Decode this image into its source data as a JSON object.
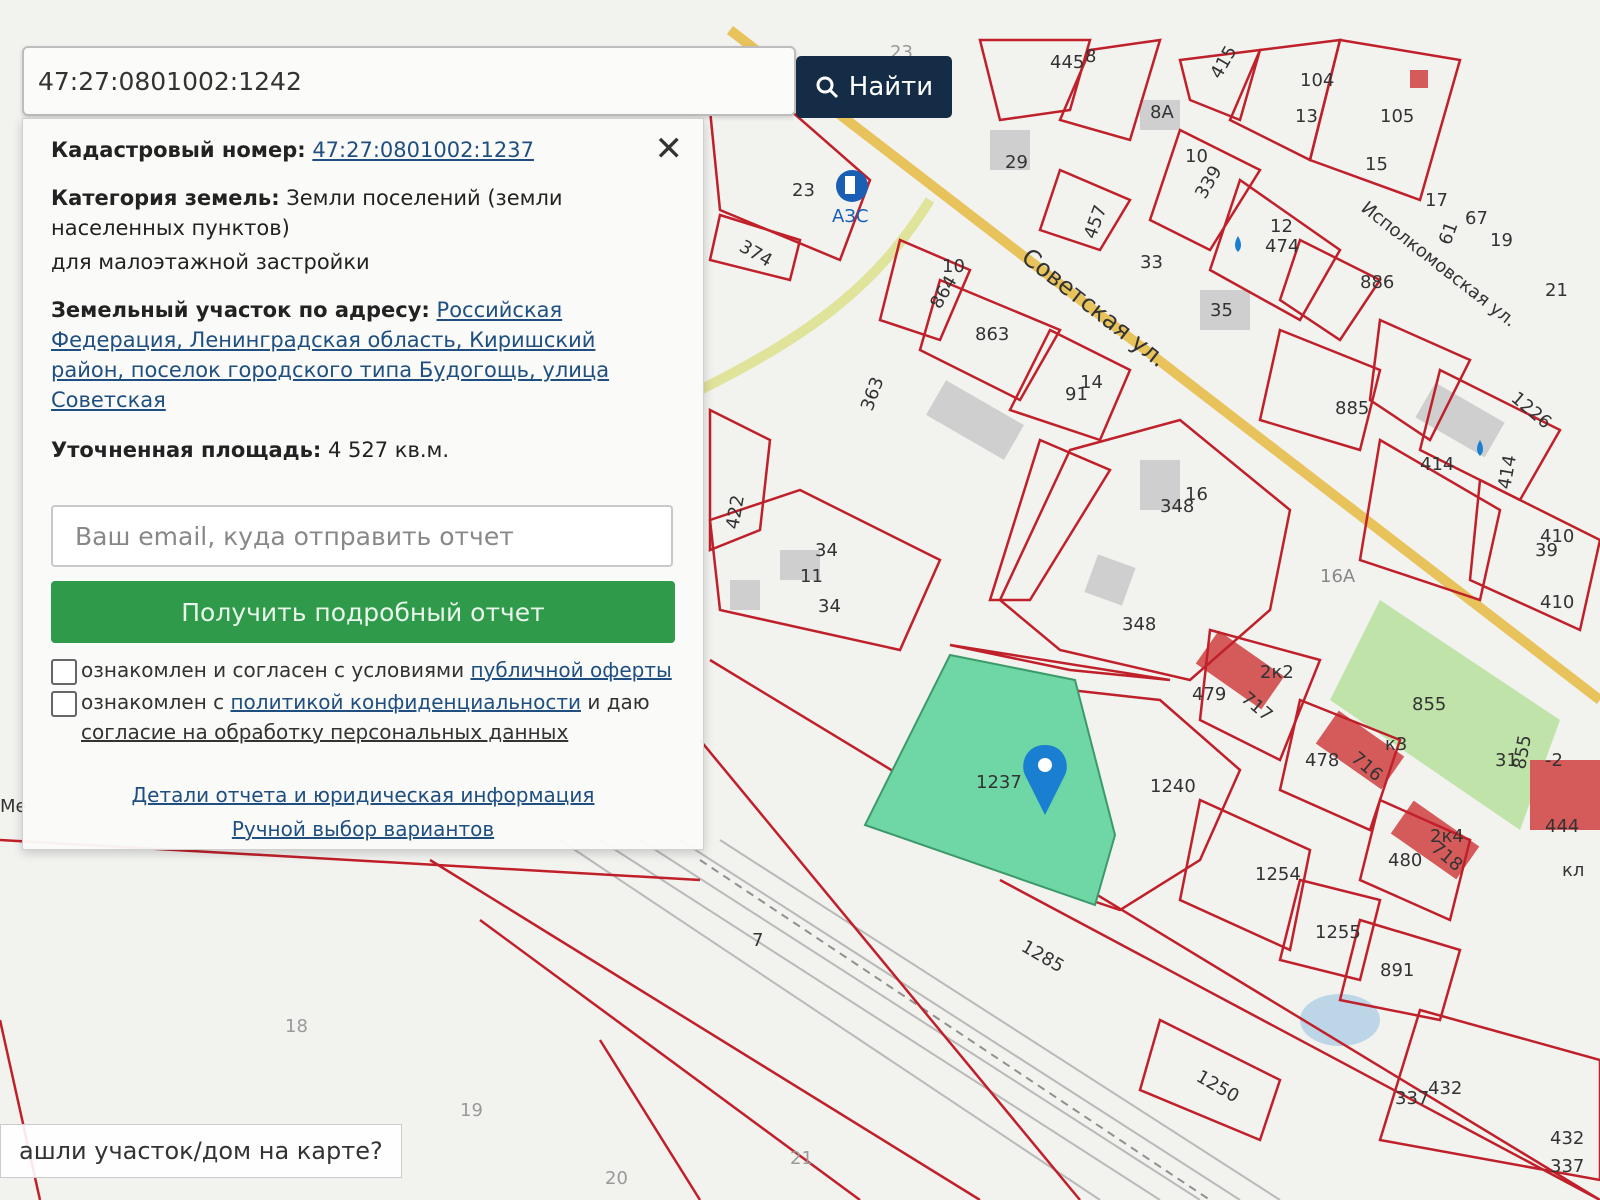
{
  "search": {
    "value": "47:27:0801002:1242",
    "button_label": "Найти"
  },
  "panel": {
    "cadastral_label": "Кадастровый номер:",
    "cadastral_value": "47:27:0801002:1237",
    "category_label": "Категория земель:",
    "category_value_1": "Земли поселений (земли",
    "category_value_2": "населенных пунктов)",
    "category_value_3": "для малоэтажной застройки",
    "address_label": "Земельный участок по адресу:",
    "address_1": "Российская",
    "address_2": "Федерация, Ленинградская область, Киришский",
    "address_3": "район, поселок городского типа Будогощь, улица",
    "address_4": "Советская",
    "area_label": "Уточненная площадь:",
    "area_value": "4 527 кв.м.",
    "email_placeholder": "Ваш email, куда отправить отчет",
    "report_button": "Получить подробный отчет",
    "offer_text": "ознакомлен и согласен с условиями",
    "offer_link": "публичной оферты",
    "privacy_text_1": "ознакомлен с",
    "privacy_link": "политикой конфиденциальности",
    "privacy_text_2": "и даю",
    "consent_link": "согласие на обработку персональных данных",
    "details_link": "Детали отчета и юридическая информация",
    "manual_link": "Ручной выбор вариантов"
  },
  "bottom_note": "ашли участок/дом на карте?",
  "map": {
    "streets": [
      "Советская ул.",
      "Исполкомовская ул."
    ],
    "poi": "АЗС",
    "selected_parcel": "1237",
    "labels": [
      "445",
      "8",
      "415",
      "104",
      "105",
      "13",
      "15",
      "17",
      "67",
      "19",
      "21",
      "61",
      "23",
      "29",
      "8А",
      "10",
      "339",
      "457",
      "12",
      "474",
      "33",
      "35",
      "886",
      "374",
      "10",
      "864",
      "863",
      "363",
      "14",
      "91",
      "885",
      "1226",
      "414",
      "414",
      "410",
      "39",
      "410",
      "422",
      "348",
      "16",
      "34",
      "11",
      "34",
      "16А",
      "348",
      "855",
      "479",
      "717",
      "2к2",
      "478",
      "716",
      "к3",
      "31",
      "855",
      "-2",
      "444",
      "кл",
      "1240",
      "480",
      "718",
      "2к4",
      "1254",
      "1255",
      "891",
      "1285",
      "7",
      "1250",
      "337",
      "432",
      "432",
      "337",
      "18",
      "19",
      "21",
      "20",
      "Ме",
      "23"
    ]
  },
  "colors": {
    "parcel_border": "#c0202a",
    "selected_fill": "#6fd6a6",
    "green_area": "#bfe3a8",
    "building": "#cfcfcf",
    "house_red": "#d55a5a",
    "street_yellow": "#e8c25a",
    "marker": "#1a7fd0",
    "button_dark": "#142c45",
    "button_green": "#2f9a4a"
  }
}
